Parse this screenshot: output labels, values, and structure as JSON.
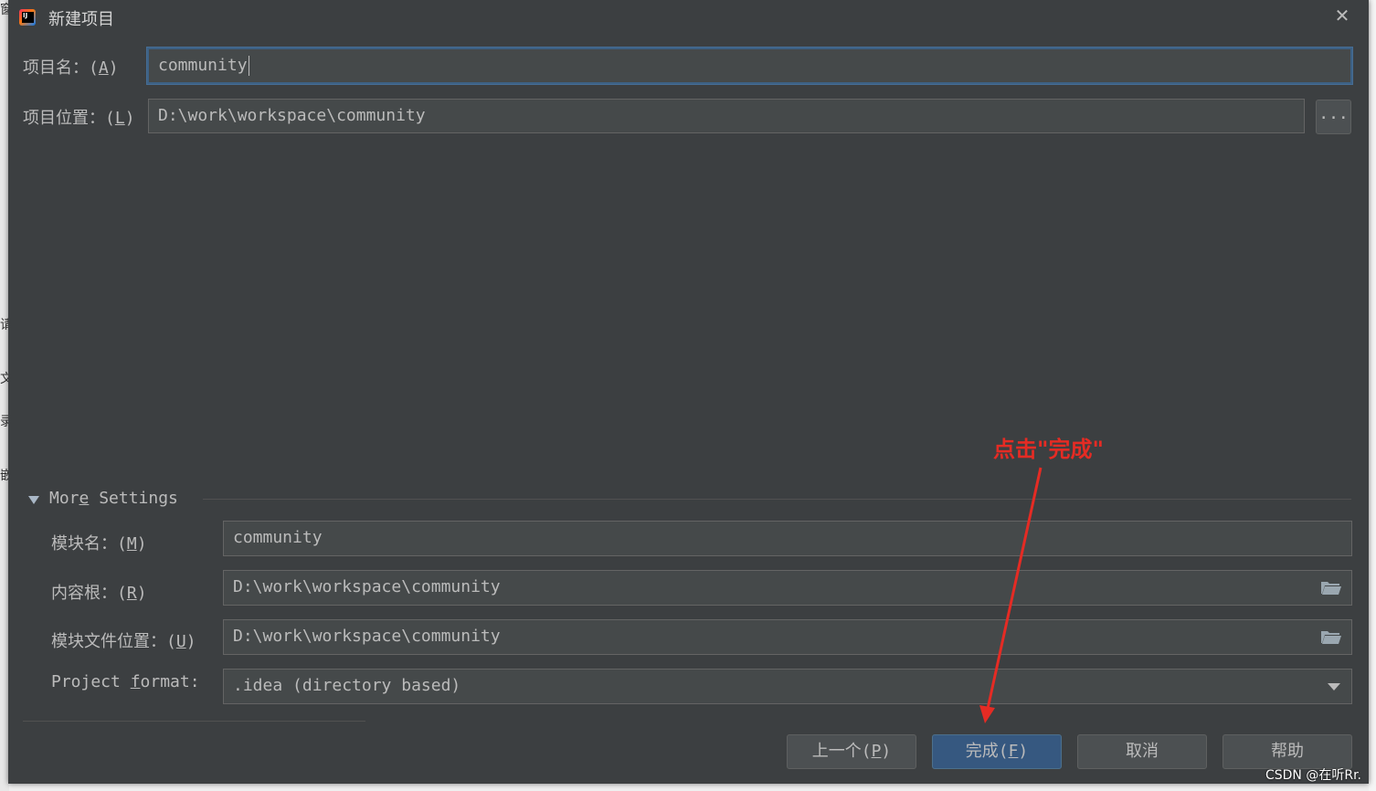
{
  "dialog": {
    "title": "新建项目",
    "close_glyph": "✕",
    "app_icon_text": "IJ"
  },
  "project_name": {
    "label": "项目名：",
    "mnemonic": "A",
    "value": "community"
  },
  "project_location": {
    "label": "项目位置：",
    "mnemonic": "L",
    "value": "D:\\work\\workspace\\community",
    "browse_label": "..."
  },
  "more_settings": {
    "title_pre": "Mor",
    "title_u": "e",
    "title_post": " Settings",
    "module_name": {
      "label": "模块名：",
      "mnemonic": "M",
      "value": "community"
    },
    "content_root": {
      "label": "内容根：",
      "mnemonic": "R",
      "value": "D:\\work\\workspace\\community"
    },
    "module_file_location": {
      "label": "模块文件位置：",
      "mnemonic": "U",
      "value": "D:\\work\\workspace\\community"
    },
    "project_format": {
      "label_pre": "Project ",
      "label_u": "f",
      "label_post": "ormat:",
      "value": ".idea (directory based)"
    }
  },
  "buttons": {
    "previous": {
      "label": "上一个",
      "mnemonic": "P"
    },
    "finish": {
      "label": "完成",
      "mnemonic": "F"
    },
    "cancel": {
      "label": "取消"
    },
    "help": {
      "label": "帮助"
    }
  },
  "annotation": {
    "text": "点击\"完成\"",
    "color": "#e52b24"
  },
  "watermark": "CSDN @在听Rr.",
  "background_fragments": [
    "窗",
    "请",
    "文",
    "录",
    "嵌"
  ],
  "colors": {
    "dialog_bg": "#3c3f41",
    "field_bg": "#45494a",
    "primary_button": "#365880",
    "focus_border": "#3d6185"
  }
}
